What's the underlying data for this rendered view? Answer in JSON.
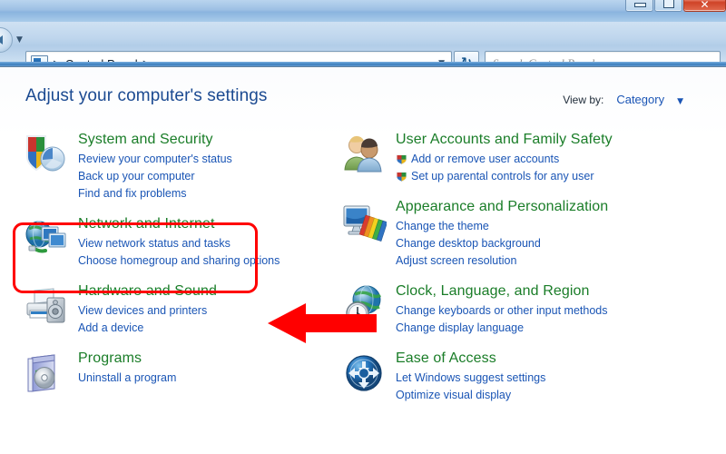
{
  "window": {
    "controls": [
      {
        "name": "minimize",
        "glyph": "—"
      },
      {
        "name": "maximize",
        "glyph": "□"
      },
      {
        "name": "close",
        "glyph": "✕"
      }
    ]
  },
  "toolbar": {
    "back_icon": "back-arrow-icon",
    "history_caret": "▼",
    "breadcrumb": {
      "icon": "control-panel-icon",
      "lead_sep": "▶",
      "label": "Control Panel",
      "trail_sep": "▶",
      "dropdown_caret": "▼"
    },
    "refresh_icon": "↻",
    "search": {
      "placeholder": "Search Control Panel",
      "value": ""
    }
  },
  "content": {
    "page_title": "Adjust your computer's settings",
    "view_by": {
      "label": "View by:",
      "value": "Category",
      "caret": "▼"
    }
  },
  "categories": {
    "left": [
      {
        "icon": "shield-security-icon",
        "heading": "System and Security",
        "links": [
          {
            "label": "Review your computer's status",
            "uac": false
          },
          {
            "label": "Back up your computer",
            "uac": false
          },
          {
            "label": "Find and fix problems",
            "uac": false
          }
        ]
      },
      {
        "icon": "network-globe-icon",
        "heading": "Network and Internet",
        "links": [
          {
            "label": "View network status and tasks",
            "uac": false
          },
          {
            "label": "Choose homegroup and sharing options",
            "uac": false
          }
        ]
      },
      {
        "icon": "printer-speaker-icon",
        "heading": "Hardware and Sound",
        "links": [
          {
            "label": "View devices and printers",
            "uac": false
          },
          {
            "label": "Add a device",
            "uac": false
          }
        ]
      },
      {
        "icon": "programs-disc-icon",
        "heading": "Programs",
        "links": [
          {
            "label": "Uninstall a program",
            "uac": false
          }
        ]
      }
    ],
    "right": [
      {
        "icon": "user-accounts-icon",
        "heading": "User Accounts and Family Safety",
        "links": [
          {
            "label": "Add or remove user accounts",
            "uac": true
          },
          {
            "label": "Set up parental controls for any user",
            "uac": true
          }
        ]
      },
      {
        "icon": "appearance-monitor-icon",
        "heading": "Appearance and Personalization",
        "links": [
          {
            "label": "Change the theme",
            "uac": false
          },
          {
            "label": "Change desktop background",
            "uac": false
          },
          {
            "label": "Adjust screen resolution",
            "uac": false
          }
        ]
      },
      {
        "icon": "clock-globe-icon",
        "heading": "Clock, Language, and Region",
        "links": [
          {
            "label": "Change keyboards or other input methods",
            "uac": false
          },
          {
            "label": "Change display language",
            "uac": false
          }
        ]
      },
      {
        "icon": "ease-of-access-icon",
        "heading": "Ease of Access",
        "links": [
          {
            "label": "Let Windows suggest settings",
            "uac": false
          },
          {
            "label": "Optimize visual display",
            "uac": false
          }
        ]
      }
    ]
  },
  "annotations": {
    "highlight_color": "#ff0000",
    "arrow_color": "#ff0000",
    "highlight_target": "Hardware and Sound",
    "arrow_direction": "left"
  },
  "colors": {
    "heading_green": "#1a7d28",
    "link_blue": "#1a55b5",
    "title_blue": "#1b4a91"
  }
}
